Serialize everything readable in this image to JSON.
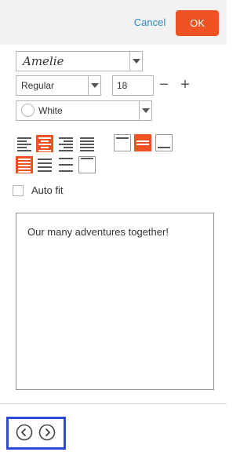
{
  "header": {
    "cancel_label": "Cancel",
    "ok_label": "OK"
  },
  "font": {
    "family_value": "Amelie",
    "weight_value": "Regular",
    "size_value": "18",
    "minus_symbol": "−",
    "plus_symbol": "+",
    "color_value": "White"
  },
  "alignment": {
    "horizontal": [
      "align-left",
      "align-center",
      "align-right",
      "align-justify"
    ],
    "horizontal_selected": "align-center",
    "vertical": [
      "valign-top",
      "valign-middle",
      "valign-bottom"
    ],
    "vertical_selected": "valign-middle",
    "spacing": [
      "spacing-fill",
      "spacing-lines",
      "spacing-even",
      "spacing-box"
    ],
    "spacing_selected": "spacing-fill"
  },
  "options": {
    "autofit_label": "Auto fit",
    "autofit_checked": false
  },
  "editor": {
    "text": "Our many adventures together!"
  },
  "colors": {
    "accent": "#f05323",
    "link": "#2a8fbd",
    "focus_outline": "#2d4ad9"
  }
}
